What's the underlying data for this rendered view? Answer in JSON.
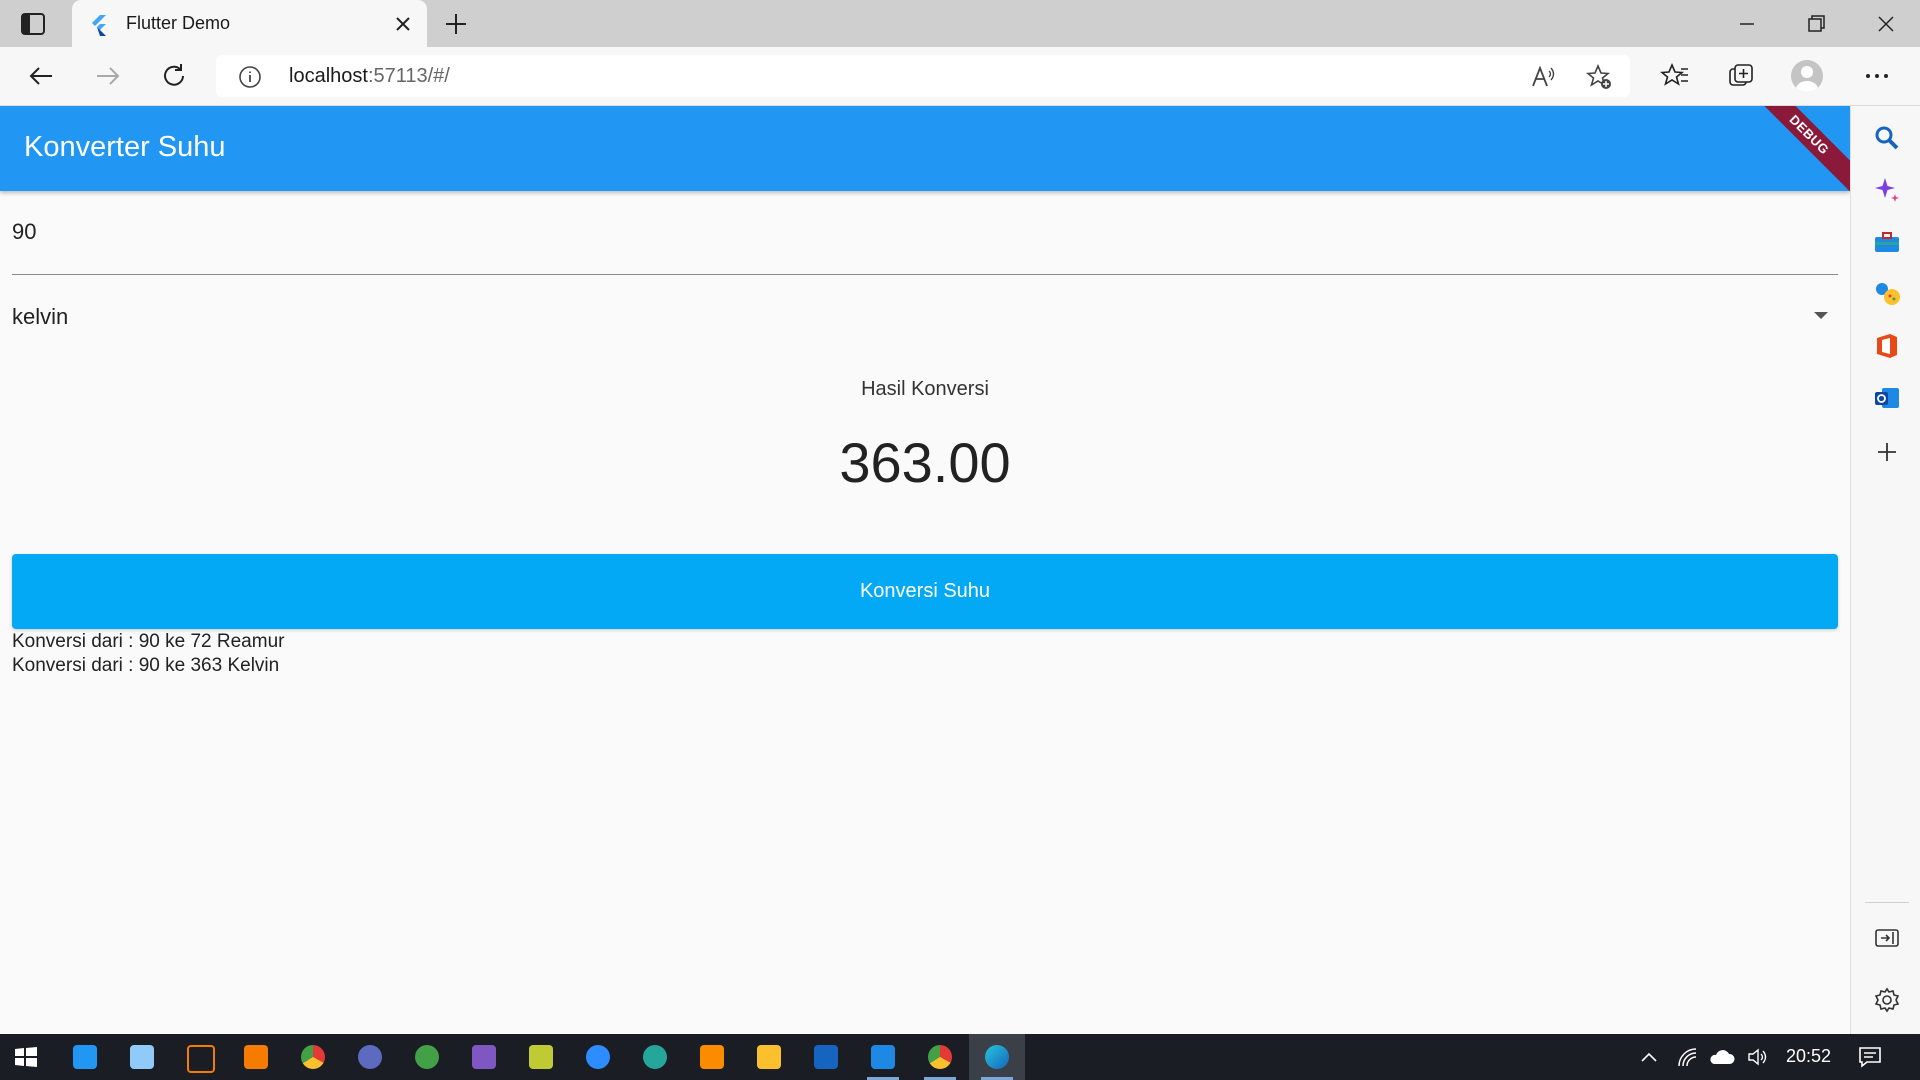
{
  "browser": {
    "tab_title": "Flutter Demo",
    "url_host": "localhost",
    "url_rest": ":57113/#/"
  },
  "app": {
    "title": "Konverter Suhu",
    "debug_banner": "DEBUG",
    "input_value": "90",
    "dropdown_selected": "kelvin",
    "result_label": "Hasil Konversi",
    "result_value": "363.00",
    "convert_button": "Konversi Suhu",
    "history": [
      "Konversi dari : 90 ke 72 Reamur",
      "Konversi dari : 90 ke 363 Kelvin"
    ]
  },
  "taskbar": {
    "clock": "20:52"
  },
  "colors": {
    "appbar": "#2196f3",
    "button": "#03a9f4",
    "debug": "#8b1a3a"
  }
}
